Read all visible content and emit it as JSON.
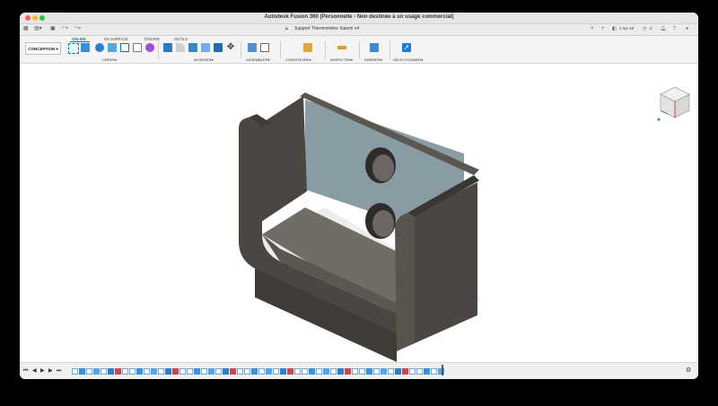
{
  "window": {
    "title": "Autodesk Fusion 360 (Personnelle - Non destinée à un usage commercial)"
  },
  "tabbar": {
    "document_name": "Support Thermomètre Xiaomi v4",
    "jobs_label": "1 sur 10",
    "extra_label": "2"
  },
  "ribbon": {
    "workspace_label": "CONCEPTION",
    "tabs": [
      "SOLIDE",
      "EN SURFACE",
      "TÔLERIE",
      "OUTILS"
    ],
    "active_tab": "SOLIDE",
    "groups": [
      "CRÉER",
      "MODIFIER",
      "ASSEMBLER",
      "CONSTRUIRE",
      "INSPECTER",
      "INSÉRER",
      "SÉLECTIONNER"
    ]
  },
  "viewcube": {
    "icon": "viewcube-icon"
  },
  "colors": {
    "accent": "#0a72c4",
    "part_side": "#4a4641",
    "part_top": "#5a5650",
    "part_inner": "#8a9ca3"
  },
  "timeline": {
    "feature_count": 52
  }
}
